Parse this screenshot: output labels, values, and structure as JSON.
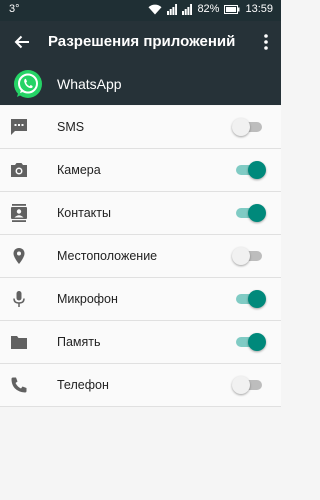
{
  "status_bar": {
    "temperature": "3°",
    "battery": "82%",
    "time": "13:59"
  },
  "toolbar": {
    "title": "Разрешения приложений"
  },
  "app": {
    "name": "WhatsApp"
  },
  "permissions": [
    {
      "label": "SMS",
      "icon": "message-icon",
      "enabled": false
    },
    {
      "label": "Камера",
      "icon": "camera-icon",
      "enabled": true
    },
    {
      "label": "Контакты",
      "icon": "contacts-icon",
      "enabled": true
    },
    {
      "label": "Местоположение",
      "icon": "location-pin-icon",
      "enabled": false
    },
    {
      "label": "Микрофон",
      "icon": "microphone-icon",
      "enabled": true
    },
    {
      "label": "Память",
      "icon": "folder-icon",
      "enabled": true
    },
    {
      "label": "Телефон",
      "icon": "phone-icon",
      "enabled": false
    }
  ],
  "colors": {
    "toolbar": "#263238",
    "accent": "#00897b",
    "accent_track": "#80cbc4",
    "whatsapp": "#25d366"
  }
}
